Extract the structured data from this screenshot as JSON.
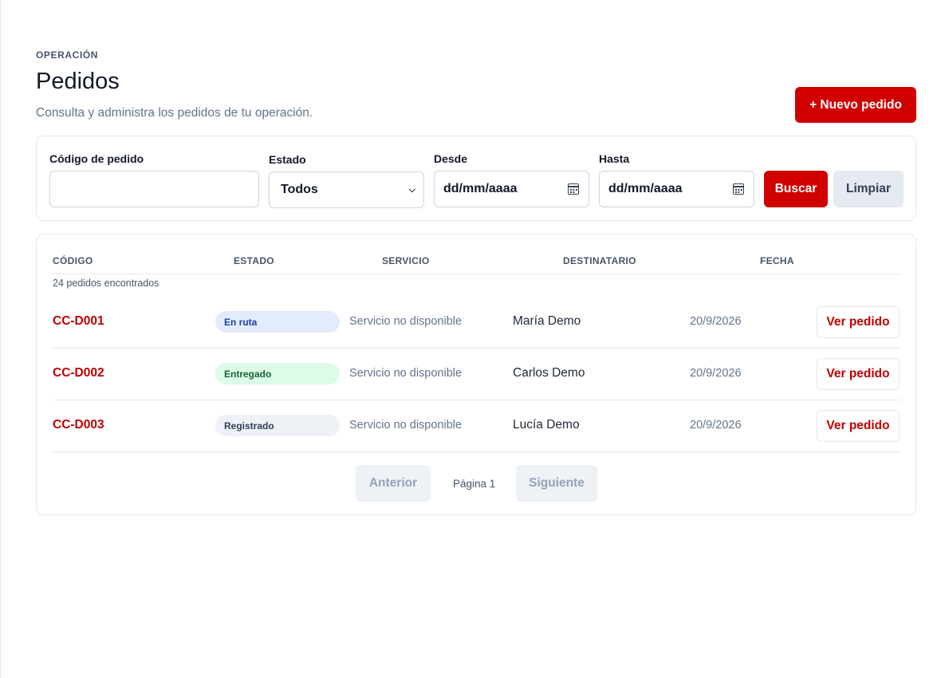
{
  "header": {
    "eyebrow": "OPERACIÓN",
    "title": "Pedidos",
    "subtitle": "Consulta y administra los pedidos de tu operación.",
    "new_button": "+ Nuevo pedido"
  },
  "filters": {
    "code_label": "Código de pedido",
    "code_value": "",
    "status_label": "Estado",
    "status_value": "Todos",
    "from_label": "Desde",
    "from_value": "dd/mm/aaaa",
    "to_label": "Hasta",
    "to_value": "dd/mm/aaaa",
    "search_button": "Buscar",
    "clear_button": "Limpiar"
  },
  "table": {
    "columns": [
      "CÓDIGO",
      "ESTADO",
      "SERVICIO",
      "DESTINATARIO",
      "FECHA"
    ],
    "count_text": "24 pedidos encontrados",
    "rows": [
      {
        "code": "CC-D001",
        "status": "En ruta",
        "service": "Servicio no disponible",
        "recipient": "María Demo",
        "date": "20/9/2026",
        "action": "Ver pedido"
      },
      {
        "code": "CC-D002",
        "status": "Entregado",
        "service": "Servicio no disponible",
        "recipient": "Carlos Demo",
        "date": "20/9/2026",
        "action": "Ver pedido"
      },
      {
        "code": "CC-D003",
        "status": "Registrado",
        "service": "Servicio no disponible",
        "recipient": "Lucía Demo",
        "date": "20/9/2026",
        "action": "Ver pedido"
      }
    ]
  },
  "pagination": {
    "prev": "Anterior",
    "page": "Página 1",
    "next": "Siguiente"
  },
  "colors": {
    "accent": "#d10000",
    "status_route": "#e2ecfb",
    "status_delivered": "#dcfce7",
    "status_registered": "#eef1f6"
  },
  "icons": {
    "date_picker": "calendar-icon",
    "select": "chevron-down-icon"
  }
}
